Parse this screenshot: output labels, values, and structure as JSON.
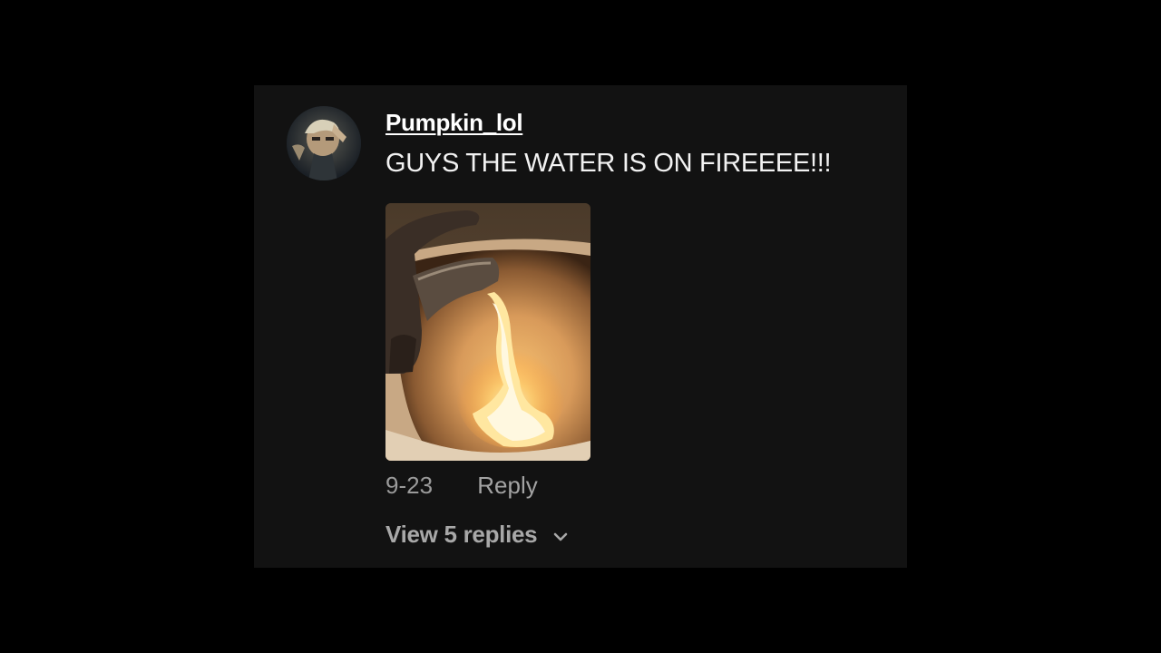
{
  "comment": {
    "username": "Pumpkin_lol",
    "text": "GUYS THE WATER IS ON FIREEEE!!!",
    "avatar_icon": "user-avatar",
    "image_icon": "faucet-fire-photo",
    "date": "9-23",
    "reply_label": "Reply",
    "view_replies_label": "View 5 replies",
    "expand_icon": "chevron-down-icon"
  },
  "colors": {
    "page_background": "#000000",
    "card_background": "#121212",
    "username": "#ffffff",
    "text": "#f2f2f2",
    "meta": "#9a9a9a"
  }
}
